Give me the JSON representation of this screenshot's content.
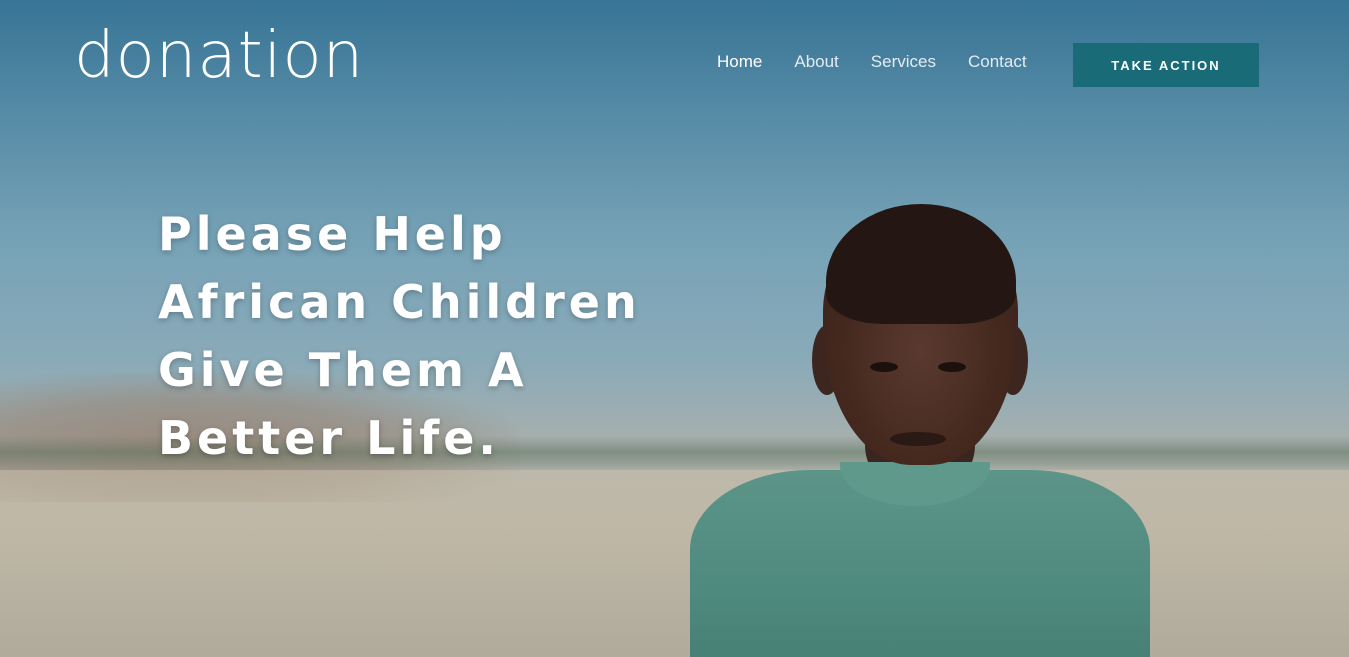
{
  "brand": {
    "logo_text": "donation"
  },
  "nav": {
    "items": [
      {
        "label": "Home"
      },
      {
        "label": "About"
      },
      {
        "label": "Services"
      },
      {
        "label": "Contact"
      }
    ],
    "cta_label": "TAKE ACTION",
    "cta_color": "#1a6b78"
  },
  "hero": {
    "headline_lines": [
      "Please Help",
      "African Children",
      "Give Them A",
      "Better Life."
    ],
    "image_subject": "child in green shirt in field"
  }
}
